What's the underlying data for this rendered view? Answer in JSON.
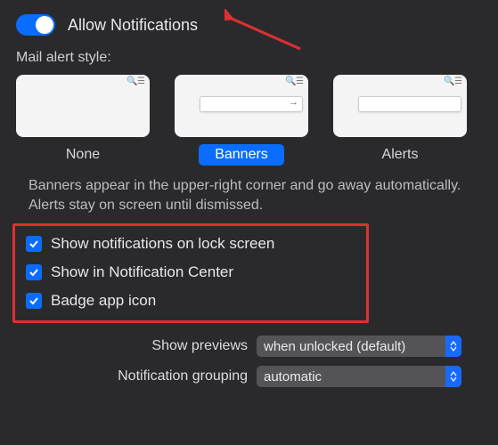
{
  "allow": {
    "label": "Allow Notifications",
    "on": true
  },
  "alertStyle": {
    "heading": "Mail alert style:",
    "options": [
      {
        "label": "None"
      },
      {
        "label": "Banners"
      },
      {
        "label": "Alerts"
      }
    ],
    "selected": "Banners",
    "description": "Banners appear in the upper-right corner and go away automatically. Alerts stay on screen until dismissed."
  },
  "checkboxes": [
    {
      "label": "Show notifications on lock screen",
      "checked": true
    },
    {
      "label": "Show in Notification Center",
      "checked": true
    },
    {
      "label": "Badge app icon",
      "checked": true
    }
  ],
  "selects": {
    "showPreviews": {
      "label": "Show previews",
      "value": "when unlocked (default)"
    },
    "grouping": {
      "label": "Notification grouping",
      "value": "automatic"
    }
  },
  "annotation": {
    "arrow_color": "#e03030"
  }
}
